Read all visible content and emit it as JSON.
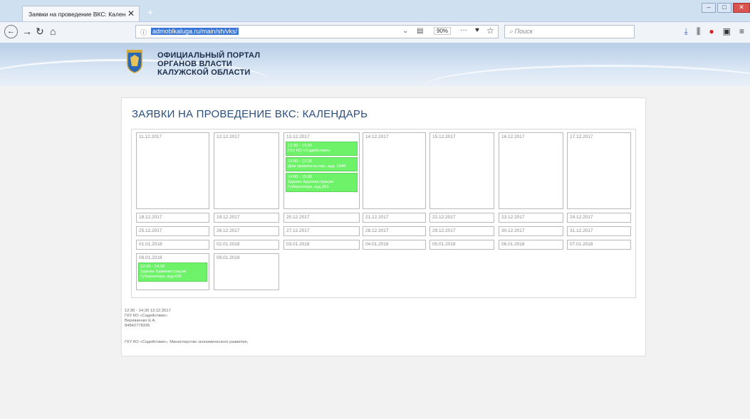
{
  "browser": {
    "tab_title": "Заявки на проведение ВКС: Кален",
    "tab_close": "✕",
    "new_tab": "+",
    "url": "admoblkaluga.ru/main/sh/vks/",
    "zoom": "90%",
    "search_placeholder": "Поиск"
  },
  "portal": {
    "title_line1": "ОФИЦИАЛЬНЫЙ ПОРТАЛ",
    "title_line2": "ОРГАНОВ ВЛАСТИ",
    "title_line3": "КАЛУЖСКОЙ ОБЛАСТИ"
  },
  "page_title": "ЗАЯВКИ НА ПРОВЕДЕНИЕ ВКС: КАЛЕНДАРЬ",
  "weeks": [
    {
      "days": [
        "11.12.2017",
        "12.12.2017",
        "13.12.2017",
        "14.12.2017",
        "15.12.2017",
        "16.12.2017",
        "17.12.2017"
      ]
    },
    {
      "days": [
        "18.12.2017",
        "19.12.2017",
        "20.12.2017",
        "21.12.2017",
        "22.12.2017",
        "23.12.2017",
        "24.12.2017"
      ]
    },
    {
      "days": [
        "25.12.2017",
        "26.12.2017",
        "27.12.2017",
        "28.12.2017",
        "29.12.2017",
        "30.12.2017",
        "31.12.2017"
      ]
    },
    {
      "days": [
        "01.01.2018",
        "02.01.2018",
        "03.01.2018",
        "04.01.2018",
        "05.01.2018",
        "06.01.2018",
        "07.01.2018"
      ]
    },
    {
      "days": [
        "08.01.2018",
        "09.01.2018"
      ]
    }
  ],
  "events_13_12": [
    {
      "time": "12:30 - 14:30",
      "place": "ГКУ КО «Содействие»"
    },
    {
      "time": "12:00 - 12:30",
      "place": "Дом правительства, ауд. 104б"
    },
    {
      "time": "14:00 - 15:00",
      "place": "Здание Администрации Губернатора, ауд.361"
    }
  ],
  "events_08_01": [
    {
      "time": "12:00 - 14:00",
      "place": "Здание Администрации Губернатора, ауд.435"
    }
  ],
  "details": {
    "line1": "12:30 - 14:30 13.12.2017",
    "line2": "ГКУ КО «Содействие»",
    "line3": "Веревкенко Е.А.",
    "line4": "84842778335",
    "line5": "ГКУ КО «Содействие», Министерство экономического развития,"
  }
}
